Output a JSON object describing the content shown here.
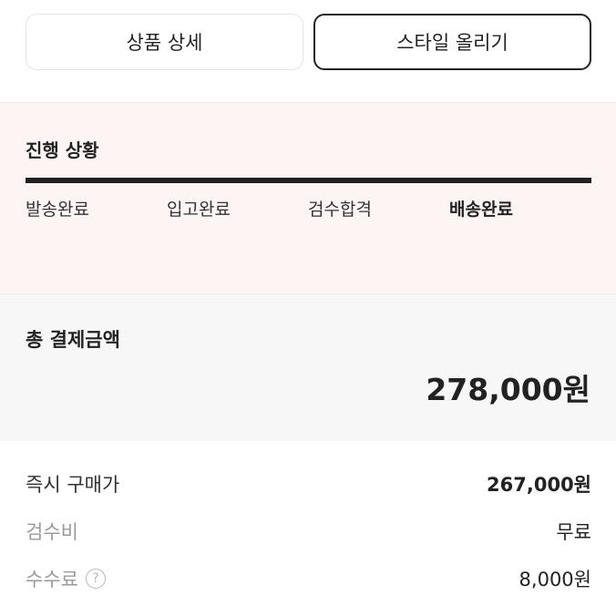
{
  "buttons": {
    "product_detail": "상품 상세",
    "upload_style": "스타일 올리기"
  },
  "progress": {
    "title": "진행 상황",
    "steps": [
      {
        "label": "발송완료",
        "active": false
      },
      {
        "label": "입고완료",
        "active": false
      },
      {
        "label": "검수합격",
        "active": false
      },
      {
        "label": "배송완료",
        "active": true
      }
    ],
    "completion": 1.0
  },
  "total": {
    "label": "총 결제금액",
    "amount": "278,000원"
  },
  "details": [
    {
      "label": "즉시 구매가",
      "value": "267,000원"
    },
    {
      "label": "검수비",
      "value": "무료"
    },
    {
      "label": "수수료",
      "value": "8,000원",
      "help": "?"
    }
  ],
  "colors": {
    "progress_bg": "#fdf4f4",
    "total_bg": "#f7f7f7",
    "text_primary": "#222222",
    "text_muted": "#9a9a9a"
  }
}
